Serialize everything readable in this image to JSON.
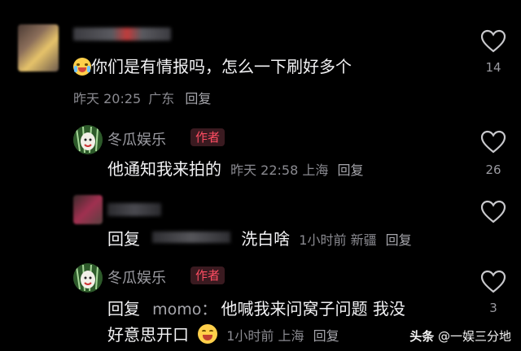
{
  "comments": [
    {
      "text": "你们是有情报吗，怎么一下刷好多个",
      "time": "昨天 20:25",
      "location": "广东",
      "reply_label": "回复",
      "likes": "14",
      "emoji": "crying-face-icon"
    },
    {
      "author": "冬瓜娱乐",
      "badge": "作者",
      "text": "他通知我来拍的",
      "time": "昨天 22:58",
      "location": "上海",
      "reply_label": "回复",
      "likes": "26"
    },
    {
      "prefix": "回复",
      "text": "洗白啥",
      "time": "1小时前",
      "location": "新疆",
      "reply_label": "回复",
      "likes": ""
    },
    {
      "author": "冬瓜娱乐",
      "badge": "作者",
      "prefix": "回复",
      "mention": "momo：",
      "text_line1": "他喊我来问窝子问题 我没",
      "text_line2": "好意思开口",
      "time": "1小时前",
      "location": "上海",
      "reply_label": "回复",
      "likes": "3",
      "emoji": "laughing-face-icon"
    }
  ],
  "watermark": {
    "brand": "头条",
    "handle": "@一娱三分地"
  },
  "colors": {
    "background": "#000000",
    "author_badge": "#ff4d62",
    "meta_text": "#8a8a90"
  }
}
